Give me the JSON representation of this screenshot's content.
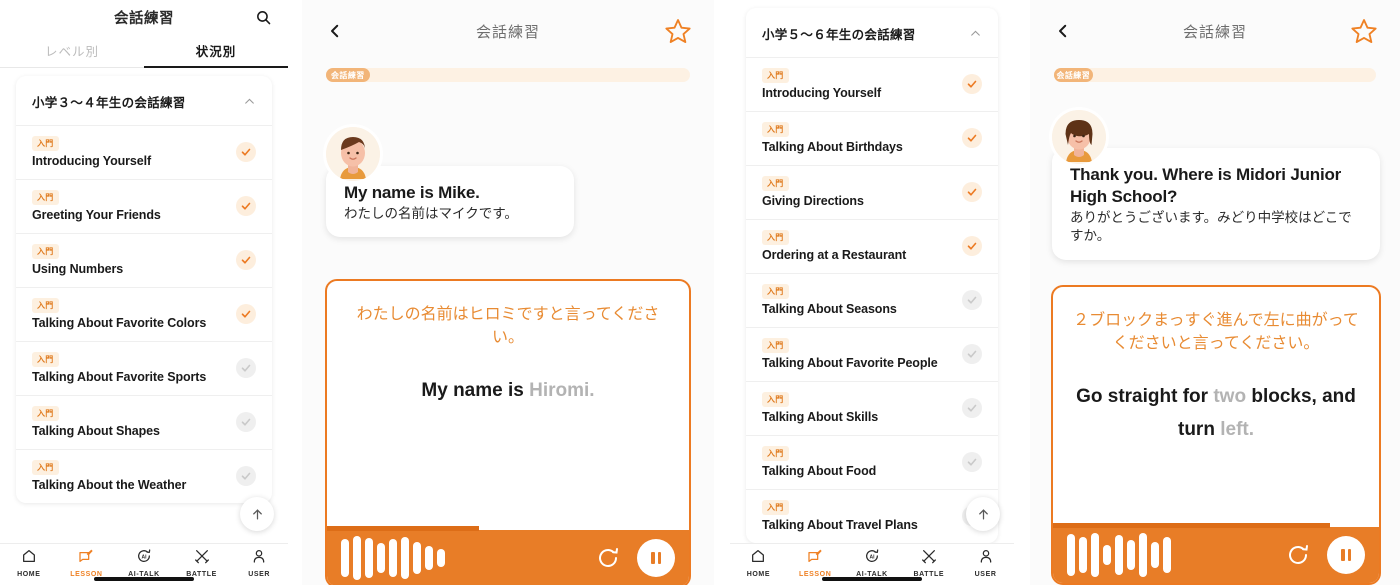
{
  "app": {
    "accent": "#ef8124",
    "accent_dark": "#e87d27",
    "badge_bg": "#fdf0e0",
    "badge_fg": "#e07b1f"
  },
  "panel1": {
    "header": {
      "title": "会話練習",
      "search_icon": "search-icon"
    },
    "tabs": [
      {
        "label": "レベル別",
        "active": false
      },
      {
        "label": "状況別",
        "active": true
      }
    ],
    "group": {
      "title": "小学３～４年生の会話練習",
      "chevron": "chevron-up-icon",
      "lessons": [
        {
          "badge": "入門",
          "name": "Introducing Yourself",
          "done": true
        },
        {
          "badge": "入門",
          "name": "Greeting Your Friends",
          "done": true
        },
        {
          "badge": "入門",
          "name": "Using Numbers",
          "done": true
        },
        {
          "badge": "入門",
          "name": "Talking About Favorite Colors",
          "done": true
        },
        {
          "badge": "入門",
          "name": "Talking About Favorite Sports",
          "done": false
        },
        {
          "badge": "入門",
          "name": "Talking About Shapes",
          "done": false
        },
        {
          "badge": "入門",
          "name": "Talking About the Weather",
          "done": false
        }
      ]
    },
    "scroll_top_icon": "arrow-up-icon"
  },
  "panel2": {
    "header": {
      "title": "会話練習",
      "back_icon": "chevron-left-icon",
      "favorite_icon": "star-outline-icon"
    },
    "progress": {
      "label": "会話練習",
      "percent": 12
    },
    "message": {
      "avatar": "avatar-mike",
      "english": "My name is Mike.",
      "japanese": "わたしの名前はマイクです。"
    },
    "answer": {
      "prompt_ja": "わたしの名前はヒロミですと言ってください。",
      "answer_prefix": "My name is ",
      "answer_blank": "Hiromi.",
      "player": {
        "progress_percent": 42,
        "replay_icon": "replay-icon",
        "pause_icon": "pause-icon",
        "waveform": [
          38,
          44,
          40,
          30,
          38,
          42,
          32,
          24,
          18
        ]
      }
    }
  },
  "panel3": {
    "group": {
      "title": "小学５～６年生の会話練習",
      "chevron": "chevron-up-icon",
      "lessons": [
        {
          "badge": "入門",
          "name": "Introducing Yourself",
          "done": true
        },
        {
          "badge": "入門",
          "name": "Talking About Birthdays",
          "done": true
        },
        {
          "badge": "入門",
          "name": "Giving Directions",
          "done": true
        },
        {
          "badge": "入門",
          "name": "Ordering at a Restaurant",
          "done": true
        },
        {
          "badge": "入門",
          "name": "Talking About Seasons",
          "done": false
        },
        {
          "badge": "入門",
          "name": "Talking About Favorite People",
          "done": false
        },
        {
          "badge": "入門",
          "name": "Talking About Skills",
          "done": false
        },
        {
          "badge": "入門",
          "name": "Talking About Food",
          "done": false
        },
        {
          "badge": "入門",
          "name": "Talking About Travel Plans",
          "done": false
        }
      ]
    },
    "scroll_top_icon": "arrow-up-icon"
  },
  "panel4": {
    "header": {
      "title": "会話練習",
      "back_icon": "chevron-left-icon",
      "favorite_icon": "star-outline-icon"
    },
    "progress": {
      "label": "会話練習",
      "percent": 10
    },
    "message": {
      "avatar": "avatar-midori",
      "english": "Thank you. Where is Midori Junior High School?",
      "japanese": "ありがとうございます。みどり中学校はどこですか。"
    },
    "answer": {
      "prompt_ja": "２ブロックまっすぐ進んで左に曲がってくださいと言ってください。",
      "answer_line1_a": "Go straight for ",
      "answer_line1_blank": "two",
      "answer_line1_b": " blocks, and",
      "answer_line2_a": "turn ",
      "answer_line2_blank": "left.",
      "player": {
        "progress_percent": 85,
        "replay_icon": "replay-icon",
        "pause_icon": "pause-icon",
        "waveform": [
          42,
          36,
          44,
          20,
          40,
          30,
          44,
          26,
          36
        ]
      }
    }
  },
  "bottom_nav": {
    "items": [
      {
        "label": "HOME",
        "icon": "home-icon",
        "active": false
      },
      {
        "label": "LESSON",
        "icon": "lesson-icon",
        "active": true
      },
      {
        "label": "AI-TALK",
        "icon": "ai-talk-icon",
        "active": false
      },
      {
        "label": "BATTLE",
        "icon": "battle-swords-icon",
        "active": false
      },
      {
        "label": "USER",
        "icon": "user-icon",
        "active": false
      }
    ]
  }
}
